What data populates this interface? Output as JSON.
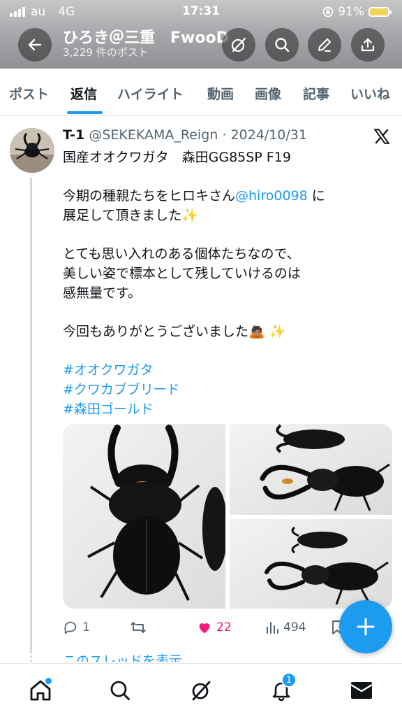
{
  "status_bar": {
    "carrier": "au",
    "network": "4G",
    "time": "17:31",
    "battery": "91%"
  },
  "header": {
    "title": "ひろき＠三重　FwooD",
    "subtitle": "3,229 件のポスト"
  },
  "tabs": [
    {
      "label": "ポスト"
    },
    {
      "label": "返信"
    },
    {
      "label": "ハイライト"
    },
    {
      "label": "動画"
    },
    {
      "label": "画像"
    },
    {
      "label": "記事"
    },
    {
      "label": "いいね"
    }
  ],
  "tweet": {
    "author_name": "T-1",
    "author_handle": "@SEKEKAMA_Reign",
    "separator": "·",
    "date": "2024/10/31",
    "line1": "国産オオクワガタ　森田GG85SP F19",
    "line2a": "今期の種親たちをヒロキさん",
    "mention": "@hiro0098",
    "line2b": " に",
    "line3": "展足して頂きました✨",
    "line4": "とても思い入れのある個体たちなので、",
    "line5": "美しい姿で標本として残していけるのは",
    "line6": "感無量です。",
    "line7": "今回もありがとうございました🙇🏽 ✨",
    "hashtags": [
      "#オオクワガタ",
      "#クワカブブリード",
      "#森田ゴールド"
    ],
    "replies": "1",
    "likes": "22",
    "views": "494",
    "show_thread": "このスレッドを表示"
  },
  "bottom_nav": {
    "notifications_badge": "1"
  },
  "colors": {
    "accent": "#1d9bf0",
    "like": "#f91880",
    "text": "#0f1419",
    "secondary": "#536471"
  }
}
